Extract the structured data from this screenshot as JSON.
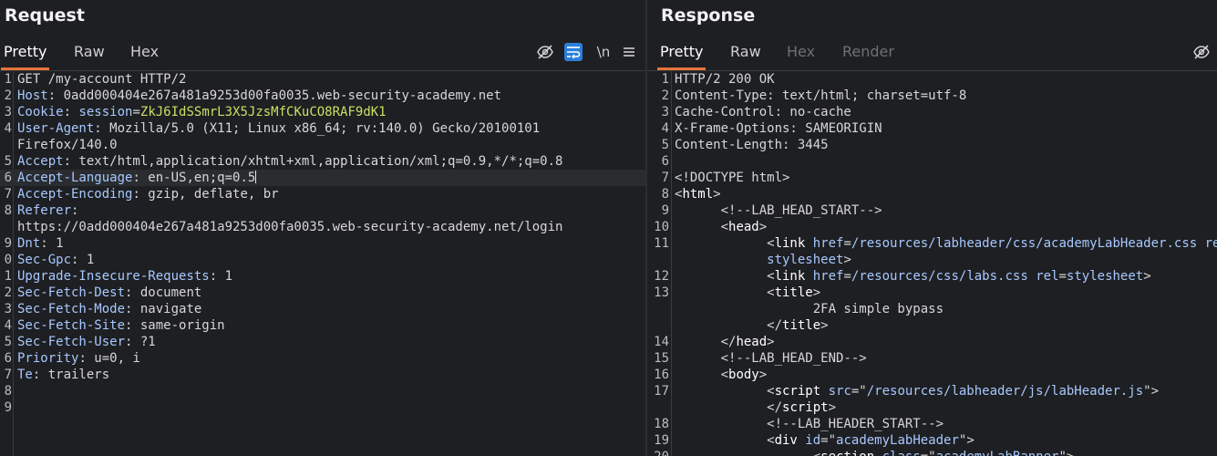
{
  "request": {
    "title": "Request",
    "tabs": [
      "Pretty",
      "Raw",
      "Hex"
    ],
    "newline_label": "\\n",
    "lines": [
      {
        "n": "1",
        "parts": [
          [
            "hv",
            "GET /my-account HTTP/2"
          ]
        ]
      },
      {
        "n": "2",
        "parts": [
          [
            "hn",
            "Host"
          ],
          [
            "hv",
            ": 0add000404e267a481a9253d00fa0035.web-security-academy.net"
          ]
        ]
      },
      {
        "n": "3",
        "parts": [
          [
            "hn",
            "Cookie"
          ],
          [
            "hv",
            ": "
          ],
          [
            "ck",
            "session"
          ],
          [
            "hv",
            "="
          ],
          [
            "cv",
            "ZkJ6IdSSmrL3X5JzsMfCKuCO8RAF9dK1"
          ]
        ]
      },
      {
        "n": "4",
        "parts": [
          [
            "hn",
            "User-Agent"
          ],
          [
            "hv",
            ": Mozilla/5.0 (X11; Linux x86_64; rv:140.0) Gecko/20100101"
          ]
        ]
      },
      {
        "n": "",
        "parts": [
          [
            "hv",
            "Firefox/140.0"
          ]
        ]
      },
      {
        "n": "5",
        "parts": [
          [
            "hn",
            "Accept"
          ],
          [
            "hv",
            ": text/html,application/xhtml+xml,application/xml;q=0.9,*/*;q=0.8"
          ]
        ]
      },
      {
        "n": "6",
        "hl": true,
        "caret": true,
        "parts": [
          [
            "hn",
            "Accept-Language"
          ],
          [
            "hv",
            ": en-US,en;q=0.5"
          ]
        ]
      },
      {
        "n": "7",
        "parts": [
          [
            "hn",
            "Accept-Encoding"
          ],
          [
            "hv",
            ": gzip, deflate, br"
          ]
        ]
      },
      {
        "n": "8",
        "parts": [
          [
            "hn",
            "Referer"
          ],
          [
            "hv",
            ":"
          ]
        ]
      },
      {
        "n": "",
        "parts": [
          [
            "hv",
            "https://0add000404e267a481a9253d00fa0035.web-security-academy.net/login"
          ]
        ]
      },
      {
        "n": "9",
        "parts": [
          [
            "hn",
            "Dnt"
          ],
          [
            "hv",
            ": 1"
          ]
        ]
      },
      {
        "n": "0",
        "parts": [
          [
            "hn",
            "Sec-Gpc"
          ],
          [
            "hv",
            ": 1"
          ]
        ]
      },
      {
        "n": "1",
        "parts": [
          [
            "hn",
            "Upgrade-Insecure-Requests"
          ],
          [
            "hv",
            ": 1"
          ]
        ]
      },
      {
        "n": "2",
        "parts": [
          [
            "hn",
            "Sec-Fetch-Dest"
          ],
          [
            "hv",
            ": document"
          ]
        ]
      },
      {
        "n": "3",
        "parts": [
          [
            "hn",
            "Sec-Fetch-Mode"
          ],
          [
            "hv",
            ": navigate"
          ]
        ]
      },
      {
        "n": "4",
        "parts": [
          [
            "hn",
            "Sec-Fetch-Site"
          ],
          [
            "hv",
            ": same-origin"
          ]
        ]
      },
      {
        "n": "5",
        "parts": [
          [
            "hn",
            "Sec-Fetch-User"
          ],
          [
            "hv",
            ": ?1"
          ]
        ]
      },
      {
        "n": "6",
        "parts": [
          [
            "hn",
            "Priority"
          ],
          [
            "hv",
            ": u=0, i"
          ]
        ]
      },
      {
        "n": "7",
        "parts": [
          [
            "hn",
            "Te"
          ],
          [
            "hv",
            ": trailers"
          ]
        ]
      },
      {
        "n": "8",
        "parts": []
      },
      {
        "n": "9",
        "parts": []
      }
    ]
  },
  "response": {
    "title": "Response",
    "tabs": [
      "Pretty",
      "Raw",
      "Hex",
      "Render"
    ],
    "lines": [
      {
        "n": "1",
        "parts": [
          [
            "hv",
            "HTTP/2 200 OK"
          ]
        ]
      },
      {
        "n": "2",
        "parts": [
          [
            "hv",
            "Content-Type: text/html; charset=utf-8"
          ]
        ]
      },
      {
        "n": "3",
        "parts": [
          [
            "hv",
            "Cache-Control: no-cache"
          ]
        ]
      },
      {
        "n": "4",
        "parts": [
          [
            "hv",
            "X-Frame-Options: SAMEORIGIN"
          ]
        ]
      },
      {
        "n": "5",
        "parts": [
          [
            "hv",
            "Content-Length: 3445"
          ]
        ]
      },
      {
        "n": "6",
        "parts": []
      },
      {
        "n": "7",
        "parts": [
          [
            "tx",
            "<!DOCTYPE html>"
          ]
        ]
      },
      {
        "n": "8",
        "parts": [
          [
            "br",
            "<"
          ],
          [
            "tg",
            "html"
          ],
          [
            "br",
            ">"
          ]
        ]
      },
      {
        "n": "9",
        "parts": [
          [
            "cm",
            "      <!--LAB_HEAD_START-->"
          ]
        ]
      },
      {
        "n": "10",
        "parts": [
          [
            "br",
            "      <"
          ],
          [
            "tg",
            "head"
          ],
          [
            "br",
            ">"
          ]
        ]
      },
      {
        "n": "11",
        "parts": [
          [
            "br",
            "            <"
          ],
          [
            "tg",
            "link"
          ],
          [
            "an",
            " href"
          ],
          [
            "br",
            "="
          ],
          [
            "av",
            "/resources/labheader/css/academyLabHeader.css"
          ],
          [
            "an",
            " rel"
          ],
          [
            "br",
            "="
          ]
        ]
      },
      {
        "n": "",
        "parts": [
          [
            "av",
            "            stylesheet"
          ],
          [
            "br",
            ">"
          ]
        ]
      },
      {
        "n": "12",
        "parts": [
          [
            "br",
            "            <"
          ],
          [
            "tg",
            "link"
          ],
          [
            "an",
            " href"
          ],
          [
            "br",
            "="
          ],
          [
            "av",
            "/resources/css/labs.css"
          ],
          [
            "an",
            " rel"
          ],
          [
            "br",
            "="
          ],
          [
            "av",
            "stylesheet"
          ],
          [
            "br",
            ">"
          ]
        ]
      },
      {
        "n": "13",
        "parts": [
          [
            "br",
            "            <"
          ],
          [
            "tg",
            "title"
          ],
          [
            "br",
            ">"
          ]
        ]
      },
      {
        "n": "",
        "parts": [
          [
            "tx",
            "                  2FA simple bypass"
          ]
        ]
      },
      {
        "n": "",
        "parts": [
          [
            "br",
            "            </"
          ],
          [
            "tg",
            "title"
          ],
          [
            "br",
            ">"
          ]
        ]
      },
      {
        "n": "14",
        "parts": [
          [
            "br",
            "      </"
          ],
          [
            "tg",
            "head"
          ],
          [
            "br",
            ">"
          ]
        ]
      },
      {
        "n": "15",
        "parts": [
          [
            "cm",
            "      <!--LAB_HEAD_END-->"
          ]
        ]
      },
      {
        "n": "16",
        "parts": [
          [
            "br",
            "      <"
          ],
          [
            "tg",
            "body"
          ],
          [
            "br",
            ">"
          ]
        ]
      },
      {
        "n": "17",
        "parts": [
          [
            "br",
            "            <"
          ],
          [
            "tg",
            "script"
          ],
          [
            "an",
            " src"
          ],
          [
            "br",
            "=\""
          ],
          [
            "av",
            "/resources/labheader/js/labHeader.js"
          ],
          [
            "br",
            "\">"
          ]
        ]
      },
      {
        "n": "",
        "parts": [
          [
            "br",
            "            </"
          ],
          [
            "tg",
            "script"
          ],
          [
            "br",
            ">"
          ]
        ]
      },
      {
        "n": "18",
        "parts": [
          [
            "cm",
            "            <!--LAB_HEADER_START-->"
          ]
        ]
      },
      {
        "n": "19",
        "parts": [
          [
            "br",
            "            <"
          ],
          [
            "tg",
            "div"
          ],
          [
            "an",
            " id"
          ],
          [
            "br",
            "=\""
          ],
          [
            "av",
            "academyLabHeader"
          ],
          [
            "br",
            "\">"
          ]
        ]
      },
      {
        "n": "20",
        "parts": [
          [
            "br",
            "                  <"
          ],
          [
            "tg",
            "section"
          ],
          [
            "an",
            " class"
          ],
          [
            "br",
            "=\""
          ],
          [
            "av",
            "academyLabBanner"
          ],
          [
            "br",
            "\">"
          ]
        ]
      }
    ]
  }
}
